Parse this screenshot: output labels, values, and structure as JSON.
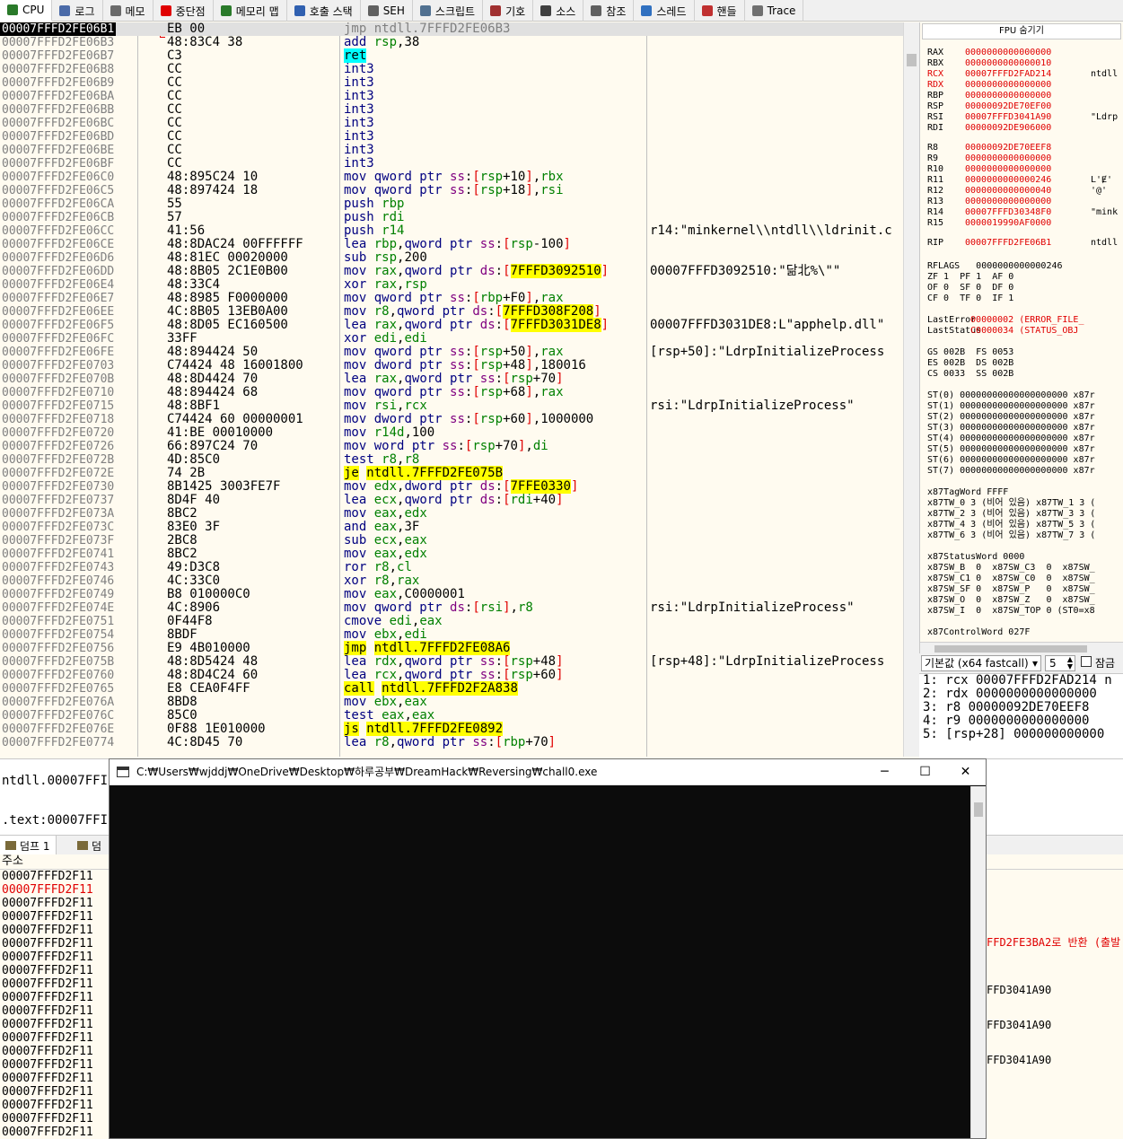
{
  "tabs": [
    {
      "label": "CPU",
      "icon": "cpu-icon",
      "color": "#2a7a2a"
    },
    {
      "label": "로그",
      "icon": "log-icon",
      "color": "#4a6aa8"
    },
    {
      "label": "메모",
      "icon": "note-icon",
      "color": "#6a6a6a"
    },
    {
      "label": "중단점",
      "icon": "breakpoint-icon",
      "color": "#e00000"
    },
    {
      "label": "메모리 맵",
      "icon": "memory-map-icon",
      "color": "#2a7a2a"
    },
    {
      "label": "호출 스택",
      "icon": "call-stack-icon",
      "color": "#3060b0"
    },
    {
      "label": "SEH",
      "icon": "seh-icon",
      "color": "#606060"
    },
    {
      "label": "스크립트",
      "icon": "script-icon",
      "color": "#507090"
    },
    {
      "label": "기호",
      "icon": "symbol-icon",
      "color": "#a03030"
    },
    {
      "label": "소스",
      "icon": "source-icon",
      "color": "#404040"
    },
    {
      "label": "참조",
      "icon": "reference-icon",
      "color": "#606060"
    },
    {
      "label": "스레드",
      "icon": "thread-icon",
      "color": "#3070c0"
    },
    {
      "label": "핸들",
      "icon": "handle-icon",
      "color": "#c03030"
    },
    {
      "label": "Trace",
      "icon": "trace-icon",
      "color": "#707070"
    }
  ],
  "disasm": [
    {
      "addr": "00007FFFD2FE06B1",
      "bytes": "EB 00",
      "instr": "jmp ntdll.7FFFD2FE06B3",
      "cmt": ""
    },
    {
      "addr": "00007FFFD2FE06B3",
      "bytes": "48:83C4 38",
      "instr": "add rsp,38",
      "cmt": ""
    },
    {
      "addr": "00007FFFD2FE06B7",
      "bytes": "C3",
      "instr": "ret",
      "cmt": ""
    },
    {
      "addr": "00007FFFD2FE06B8",
      "bytes": "CC",
      "instr": "int3",
      "cmt": ""
    },
    {
      "addr": "00007FFFD2FE06B9",
      "bytes": "CC",
      "instr": "int3",
      "cmt": ""
    },
    {
      "addr": "00007FFFD2FE06BA",
      "bytes": "CC",
      "instr": "int3",
      "cmt": ""
    },
    {
      "addr": "00007FFFD2FE06BB",
      "bytes": "CC",
      "instr": "int3",
      "cmt": ""
    },
    {
      "addr": "00007FFFD2FE06BC",
      "bytes": "CC",
      "instr": "int3",
      "cmt": ""
    },
    {
      "addr": "00007FFFD2FE06BD",
      "bytes": "CC",
      "instr": "int3",
      "cmt": ""
    },
    {
      "addr": "00007FFFD2FE06BE",
      "bytes": "CC",
      "instr": "int3",
      "cmt": ""
    },
    {
      "addr": "00007FFFD2FE06BF",
      "bytes": "CC",
      "instr": "int3",
      "cmt": ""
    },
    {
      "addr": "00007FFFD2FE06C0",
      "bytes": "48:895C24 10",
      "instr": "mov qword ptr ss:[rsp+10],rbx",
      "cmt": ""
    },
    {
      "addr": "00007FFFD2FE06C5",
      "bytes": "48:897424 18",
      "instr": "mov qword ptr ss:[rsp+18],rsi",
      "cmt": ""
    },
    {
      "addr": "00007FFFD2FE06CA",
      "bytes": "55",
      "instr": "push rbp",
      "cmt": ""
    },
    {
      "addr": "00007FFFD2FE06CB",
      "bytes": "57",
      "instr": "push rdi",
      "cmt": ""
    },
    {
      "addr": "00007FFFD2FE06CC",
      "bytes": "41:56",
      "instr": "push r14",
      "cmt": "r14:\"minkernel\\\\ntdll\\\\ldrinit.c"
    },
    {
      "addr": "00007FFFD2FE06CE",
      "bytes": "48:8DAC24 00FFFFFF",
      "instr": "lea rbp,qword ptr ss:[rsp-100]",
      "cmt": ""
    },
    {
      "addr": "00007FFFD2FE06D6",
      "bytes": "48:81EC 00020000",
      "instr": "sub rsp,200",
      "cmt": ""
    },
    {
      "addr": "00007FFFD2FE06DD",
      "bytes": "48:8B05 2C1E0B00",
      "instr": "mov rax,qword ptr ds:[7FFFD3092510]",
      "cmt": "00007FFFD3092510:\"닮北%\\\"\""
    },
    {
      "addr": "00007FFFD2FE06E4",
      "bytes": "48:33C4",
      "instr": "xor rax,rsp",
      "cmt": ""
    },
    {
      "addr": "00007FFFD2FE06E7",
      "bytes": "48:8985 F0000000",
      "instr": "mov qword ptr ss:[rbp+F0],rax",
      "cmt": ""
    },
    {
      "addr": "00007FFFD2FE06EE",
      "bytes": "4C:8B05 13EB0A00",
      "instr": "mov r8,qword ptr ds:[7FFFD308F208]",
      "cmt": ""
    },
    {
      "addr": "00007FFFD2FE06F5",
      "bytes": "48:8D05 EC160500",
      "instr": "lea rax,qword ptr ds:[7FFFD3031DE8]",
      "cmt": "00007FFFD3031DE8:L\"apphelp.dll\""
    },
    {
      "addr": "00007FFFD2FE06FC",
      "bytes": "33FF",
      "instr": "xor edi,edi",
      "cmt": ""
    },
    {
      "addr": "00007FFFD2FE06FE",
      "bytes": "48:894424 50",
      "instr": "mov qword ptr ss:[rsp+50],rax",
      "cmt": "[rsp+50]:\"LdrpInitializeProcess"
    },
    {
      "addr": "00007FFFD2FE0703",
      "bytes": "C74424 48 16001800",
      "instr": "mov dword ptr ss:[rsp+48],180016",
      "cmt": ""
    },
    {
      "addr": "00007FFFD2FE070B",
      "bytes": "48:8D4424 70",
      "instr": "lea rax,qword ptr ss:[rsp+70]",
      "cmt": ""
    },
    {
      "addr": "00007FFFD2FE0710",
      "bytes": "48:894424 68",
      "instr": "mov qword ptr ss:[rsp+68],rax",
      "cmt": ""
    },
    {
      "addr": "00007FFFD2FE0715",
      "bytes": "48:8BF1",
      "instr": "mov rsi,rcx",
      "cmt": "rsi:\"LdrpInitializeProcess\""
    },
    {
      "addr": "00007FFFD2FE0718",
      "bytes": "C74424 60 00000001",
      "instr": "mov dword ptr ss:[rsp+60],1000000",
      "cmt": ""
    },
    {
      "addr": "00007FFFD2FE0720",
      "bytes": "41:BE 00010000",
      "instr": "mov r14d,100",
      "cmt": ""
    },
    {
      "addr": "00007FFFD2FE0726",
      "bytes": "66:897C24 70",
      "instr": "mov word ptr ss:[rsp+70],di",
      "cmt": ""
    },
    {
      "addr": "00007FFFD2FE072B",
      "bytes": "4D:85C0",
      "instr": "test r8,r8",
      "cmt": ""
    },
    {
      "addr": "00007FFFD2FE072E",
      "bytes": "74 2B",
      "instr": "je ntdll.7FFFD2FE075B",
      "cmt": ""
    },
    {
      "addr": "00007FFFD2FE0730",
      "bytes": "8B1425 3003FE7F",
      "instr": "mov edx,dword ptr ds:[7FFE0330]",
      "cmt": ""
    },
    {
      "addr": "00007FFFD2FE0737",
      "bytes": "8D4F 40",
      "instr": "lea ecx,qword ptr ds:[rdi+40]",
      "cmt": ""
    },
    {
      "addr": "00007FFFD2FE073A",
      "bytes": "8BC2",
      "instr": "mov eax,edx",
      "cmt": ""
    },
    {
      "addr": "00007FFFD2FE073C",
      "bytes": "83E0 3F",
      "instr": "and eax,3F",
      "cmt": ""
    },
    {
      "addr": "00007FFFD2FE073F",
      "bytes": "2BC8",
      "instr": "sub ecx,eax",
      "cmt": ""
    },
    {
      "addr": "00007FFFD2FE0741",
      "bytes": "8BC2",
      "instr": "mov eax,edx",
      "cmt": ""
    },
    {
      "addr": "00007FFFD2FE0743",
      "bytes": "49:D3C8",
      "instr": "ror r8,cl",
      "cmt": ""
    },
    {
      "addr": "00007FFFD2FE0746",
      "bytes": "4C:33C0",
      "instr": "xor r8,rax",
      "cmt": ""
    },
    {
      "addr": "00007FFFD2FE0749",
      "bytes": "B8 010000C0",
      "instr": "mov eax,C0000001",
      "cmt": ""
    },
    {
      "addr": "00007FFFD2FE074E",
      "bytes": "4C:8906",
      "instr": "mov qword ptr ds:[rsi],r8",
      "cmt": "rsi:\"LdrpInitializeProcess\""
    },
    {
      "addr": "00007FFFD2FE0751",
      "bytes": "0F44F8",
      "instr": "cmove edi,eax",
      "cmt": ""
    },
    {
      "addr": "00007FFFD2FE0754",
      "bytes": "8BDF",
      "instr": "mov ebx,edi",
      "cmt": ""
    },
    {
      "addr": "00007FFFD2FE0756",
      "bytes": "E9 4B010000",
      "instr": "jmp ntdll.7FFFD2FE08A6",
      "cmt": ""
    },
    {
      "addr": "00007FFFD2FE075B",
      "bytes": "48:8D5424 48",
      "instr": "lea rdx,qword ptr ss:[rsp+48]",
      "cmt": "[rsp+48]:\"LdrpInitializeProcess"
    },
    {
      "addr": "00007FFFD2FE0760",
      "bytes": "48:8D4C24 60",
      "instr": "lea rcx,qword ptr ss:[rsp+60]",
      "cmt": ""
    },
    {
      "addr": "00007FFFD2FE0765",
      "bytes": "E8 CEA0F4FF",
      "instr": "call ntdll.7FFFD2F2A838",
      "cmt": ""
    },
    {
      "addr": "00007FFFD2FE076A",
      "bytes": "8BD8",
      "instr": "mov ebx,eax",
      "cmt": ""
    },
    {
      "addr": "00007FFFD2FE076C",
      "bytes": "85C0",
      "instr": "test eax,eax",
      "cmt": ""
    },
    {
      "addr": "00007FFFD2FE076E",
      "bytes": "0F88 1E010000",
      "instr": "js ntdll.7FFFD2FE0892",
      "cmt": ""
    },
    {
      "addr": "00007FFFD2FE0774",
      "bytes": "4C:8D45 70",
      "instr": "lea r8,qword ptr ss:[rbp+70]",
      "cmt": ""
    }
  ],
  "fpu_button": "FPU 숨기기",
  "registers": [
    {
      "name": "RAX",
      "value": "0000000000000000",
      "comment": ""
    },
    {
      "name": "RBX",
      "value": "0000000000000010",
      "comment": ""
    },
    {
      "name": "RCX",
      "value": "00007FFFD2FAD214",
      "comment": "ntdll"
    },
    {
      "name": "RDX",
      "value": "0000000000000000",
      "comment": ""
    },
    {
      "name": "RBP",
      "value": "0000000000000000",
      "comment": ""
    },
    {
      "name": "RSP",
      "value": "00000092DE70EF00",
      "comment": ""
    },
    {
      "name": "RSI",
      "value": "00007FFFD3041A90",
      "comment": "\"Ldrp"
    },
    {
      "name": "RDI",
      "value": "00000092DE906000",
      "comment": ""
    },
    {
      "name": "R8",
      "value": "00000092DE70EEF8",
      "comment": ""
    },
    {
      "name": "R9",
      "value": "0000000000000000",
      "comment": ""
    },
    {
      "name": "R10",
      "value": "0000000000000000",
      "comment": ""
    },
    {
      "name": "R11",
      "value": "0000000000000246",
      "comment": "L'Ɇ'"
    },
    {
      "name": "R12",
      "value": "0000000000000040",
      "comment": "'@'"
    },
    {
      "name": "R13",
      "value": "0000000000000000",
      "comment": ""
    },
    {
      "name": "R14",
      "value": "00007FFFD30348F0",
      "comment": "\"mink"
    },
    {
      "name": "R15",
      "value": "0000019990AF0000",
      "comment": ""
    },
    {
      "name": "RIP",
      "value": "00007FFFD2FE06B1",
      "comment": "ntdll"
    }
  ],
  "flags": {
    "rflags": "RFLAGS   0000000000000246",
    "l1": "ZF 1  PF 1  AF 0",
    "l2": "OF 0  SF 0  DF 0",
    "l3": "CF 0  TF 0  IF 1"
  },
  "errors": {
    "last_error_label": "LastError",
    "last_error": "00000002 (ERROR_FILE_",
    "last_status_label": "LastStatus",
    "last_status": "C0000034 (STATUS_OBJ"
  },
  "segments": [
    "GS 002B  FS 0053",
    "ES 002B  DS 002B",
    "CS 0033  SS 002B"
  ],
  "st_regs": [
    "ST(0) 00000000000000000000 x87r",
    "ST(1) 00000000000000000000 x87r",
    "ST(2) 00000000000000000000 x87r",
    "ST(3) 00000000000000000000 x87r",
    "ST(4) 00000000000000000000 x87r",
    "ST(5) 00000000000000000000 x87r",
    "ST(6) 00000000000000000000 x87r",
    "ST(7) 00000000000000000000 x87r"
  ],
  "tagword": [
    "x87TagWord FFFF",
    "x87TW_0 3 (비어 있음) x87TW_1 3 (",
    "x87TW_2 3 (비어 있음) x87TW_3 3 (",
    "x87TW_4 3 (비어 있음) x87TW_5 3 (",
    "x87TW_6 3 (비어 있음) x87TW_7 3 ("
  ],
  "statusword": [
    "x87StatusWord 0000",
    "x87SW_B  0  x87SW_C3  0  x87SW_",
    "x87SW_C1 0  x87SW_C0  0  x87SW_",
    "x87SW_SF 0  x87SW_P   0  x87SW_",
    "x87SW_O  0  x87SW_Z   0  x87SW_",
    "x87SW_I  0  x87SW_TOP 0 (ST0=x8"
  ],
  "controlword": "x87ControlWord 027F",
  "callconv": {
    "selected": "기본값 (x64 fastcall)",
    "count": "5",
    "lock_label": "잠금"
  },
  "args": [
    "1: rcx 00007FFFD2FAD214 n",
    "2: rdx 0000000000000000",
    "3: r8 00000092DE70EEF8",
    "4: r9 0000000000000000",
    "5: [rsp+28] 000000000000"
  ],
  "info": {
    "line1": "ntdll.00007FFI",
    "line2": ".text:00007FFI"
  },
  "dump": {
    "tabs": [
      "덤프 1",
      "덤"
    ],
    "header": "주소",
    "rows": [
      "00007FFFD2F11",
      "00007FFFD2F11",
      "00007FFFD2F11",
      "00007FFFD2F11",
      "00007FFFD2F11",
      "00007FFFD2F11",
      "00007FFFD2F11",
      "00007FFFD2F11",
      "00007FFFD2F11",
      "00007FFFD2F11",
      "00007FFFD2F11",
      "00007FFFD2F11",
      "00007FFFD2F11",
      "00007FFFD2F11",
      "00007FFFD2F11",
      "00007FFFD2F11",
      "00007FFFD2F11",
      "00007FFFD2F11",
      "00007FFFD2F11",
      "00007FFFD2F11",
      "00007FFFD2F11"
    ]
  },
  "stack_fragment": {
    "line1": "FFD2FE3BA2로 반환 (출발",
    "line2": "FFD3041A90",
    "line3": "FFD3041A90",
    "line4": "FFD3041A90"
  },
  "console": {
    "title": "C:₩Users₩wjddj₩OneDrive₩Desktop₩하루공부₩DreamHack₩Reversing₩chall0.exe",
    "minimize": "─",
    "maximize": "☐",
    "close": "✕"
  },
  "colors": {
    "highlight_yellow": "#ffff00",
    "highlight_cyan": "#00ffff",
    "changed_red": "#e00000"
  }
}
